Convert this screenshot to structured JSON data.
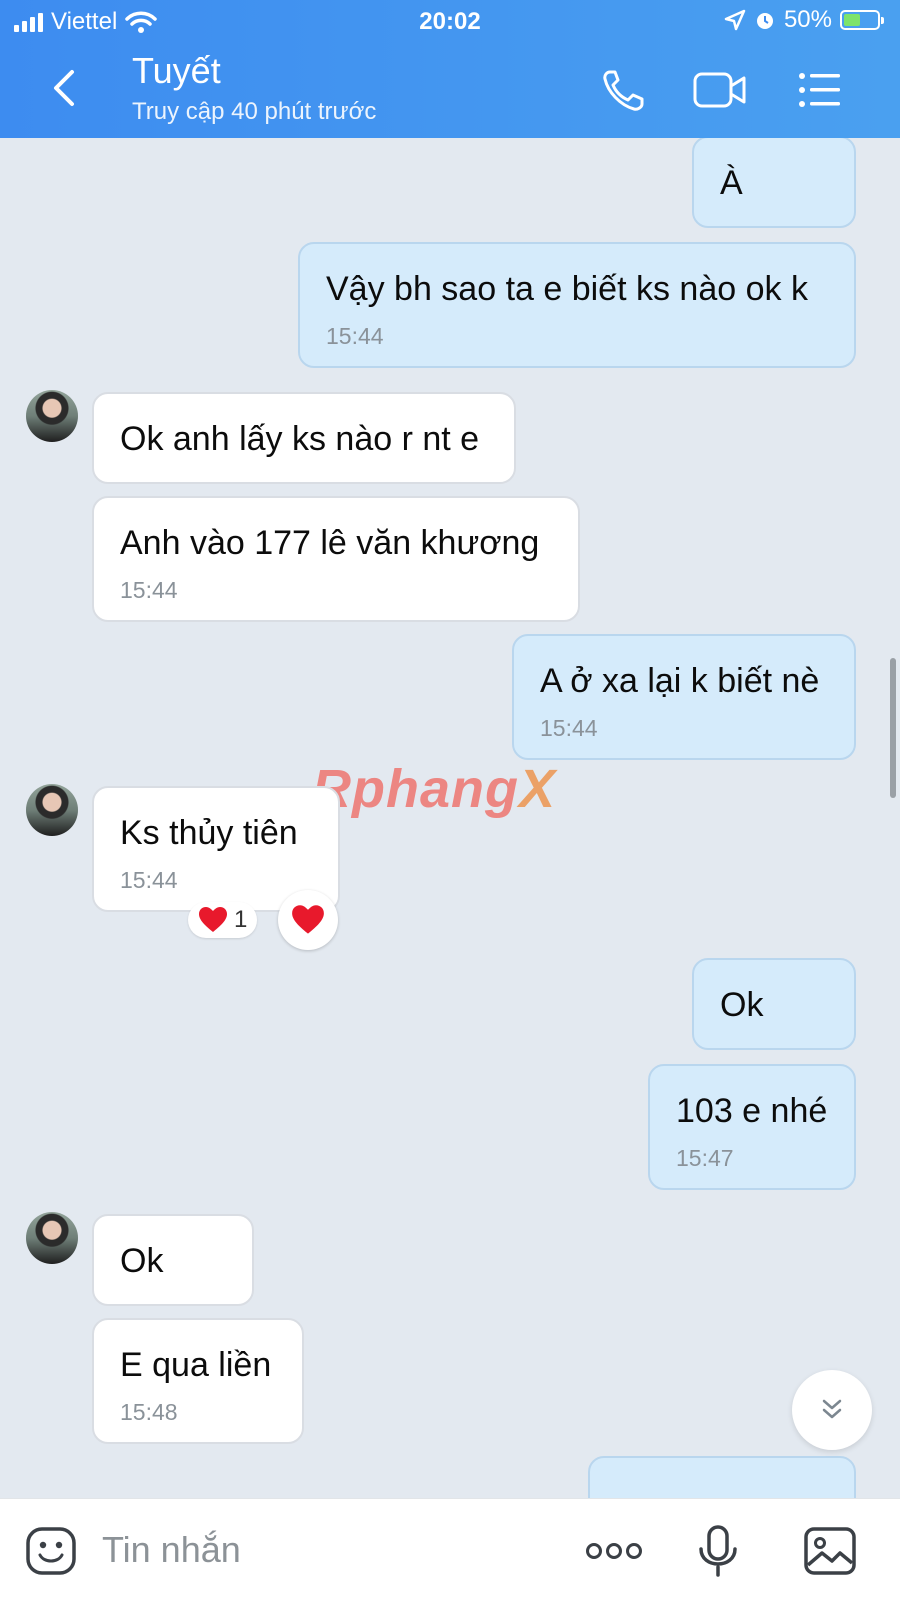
{
  "status_bar": {
    "carrier": "Viettel",
    "time": "20:02",
    "battery": "50%",
    "battery_level": 0.5
  },
  "header": {
    "name": "Tuyết",
    "status": "Truy cập 40 phút trước"
  },
  "messages": [
    {
      "dir": "out",
      "text": "À",
      "time": ""
    },
    {
      "dir": "out",
      "text": "Vậy bh sao ta e biết ks nào ok k",
      "time": "15:44"
    },
    {
      "dir": "in",
      "text": "Ok anh lấy ks nào r nt e",
      "time": ""
    },
    {
      "dir": "in",
      "text": "Anh vào 177 lê văn khương",
      "time": "15:44"
    },
    {
      "dir": "out",
      "text": "A ở xa lại k biết nè",
      "time": "15:44"
    },
    {
      "dir": "in",
      "text": "Ks thủy tiên",
      "time": "15:44",
      "reaction_count": "1"
    },
    {
      "dir": "out",
      "text": "Ok",
      "time": ""
    },
    {
      "dir": "out",
      "text": "103 e nhé",
      "time": "15:47"
    },
    {
      "dir": "in",
      "text": "Ok",
      "time": ""
    },
    {
      "dir": "in",
      "text": "E qua liền",
      "time": "15:48"
    }
  ],
  "watermark": {
    "part1": "Rphang",
    "part2": "X"
  },
  "composer": {
    "placeholder": "Tin nhắn"
  },
  "colors": {
    "header_accent": "#3d8cf0",
    "outgoing_bubble": "#d5ebfb",
    "incoming_bubble": "#ffffff",
    "heart": "#e8192c"
  },
  "icons": {
    "back": "chevron-left-icon",
    "call": "phone-icon",
    "video": "video-camera-icon",
    "menu": "list-menu-icon",
    "emoji": "emoji-icon",
    "more": "more-dots-icon",
    "mic": "microphone-icon",
    "image": "image-icon",
    "scroll": "double-chevron-down-icon"
  }
}
